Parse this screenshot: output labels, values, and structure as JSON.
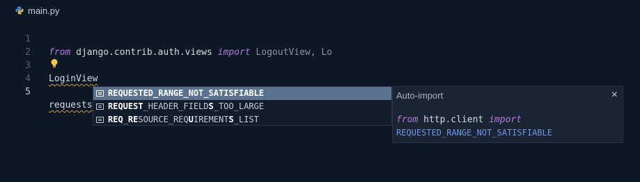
{
  "tab": {
    "filename": "main.py",
    "icon": "python-file-icon"
  },
  "editor": {
    "lines": [
      {
        "number": "1",
        "kw1": "from",
        "text1": " django.contrib.auth.views ",
        "kw2": "import",
        "text2": " LogoutView, Lo"
      },
      {
        "number": "2"
      },
      {
        "number": "3",
        "text": "LoginView"
      },
      {
        "number": "4"
      },
      {
        "number": "5",
        "text": "requests"
      }
    ]
  },
  "suggestions": {
    "items": [
      {
        "match": "REQUESTED",
        "rest": "_RANGE_NOT_SATISFIABLE",
        "selected": true
      },
      {
        "parts": [
          "REQUEST",
          "_HEADER_FIELD",
          "S",
          "_TOO_LARGE"
        ]
      },
      {
        "parts": [
          "REQ",
          "_",
          "RE",
          "SOURCE_REQ",
          "U",
          "IREMENT",
          "S",
          "_LIST"
        ]
      }
    ]
  },
  "detail": {
    "title": "Auto-import",
    "close": "×",
    "kw_from": "from",
    "module": " http.client ",
    "kw_import": "import",
    "symbol": "REQUESTED_RANGE_NOT_SATISFIABLE"
  },
  "colors": {
    "background": "#0e1726",
    "keyword": "#b27cd9",
    "selection": "#5a7290",
    "warning_squiggle": "#c9a227",
    "symbol": "#6f96e6"
  }
}
